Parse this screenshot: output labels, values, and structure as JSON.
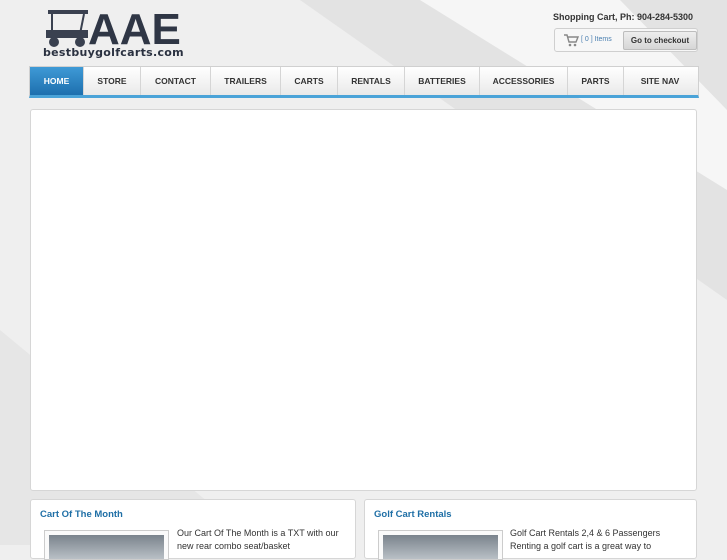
{
  "header": {
    "logo_text": "AAE",
    "site_url": "bestbuygolfcarts.com",
    "phone_line": "Shopping Cart, Ph: 904-284-5300",
    "cart_items": "[ 0 ] Items",
    "checkout_label": "Go to checkout"
  },
  "nav": {
    "items": [
      {
        "label": "HOME"
      },
      {
        "label": "STORE"
      },
      {
        "label": "CONTACT"
      },
      {
        "label": "TRAILERS"
      },
      {
        "label": "CARTS"
      },
      {
        "label": "RENTALS"
      },
      {
        "label": "BATTERIES"
      },
      {
        "label": "ACCESSORIES"
      },
      {
        "label": "PARTS"
      },
      {
        "label": "SITE NAV"
      }
    ]
  },
  "boxes": [
    {
      "title": "Cart Of The Month",
      "text": "Our Cart Of The Month is a TXT with our new rear combo seat/basket"
    },
    {
      "title": "Golf Cart Rentals",
      "text": "Golf Cart Rentals 2,4 & 6 Passengers Renting a golf cart is a great way to"
    }
  ],
  "colors": {
    "accent": "#2b86c8",
    "title_blue": "#1f6fa6"
  },
  "icons": {
    "cart": "shopping-cart-icon"
  }
}
